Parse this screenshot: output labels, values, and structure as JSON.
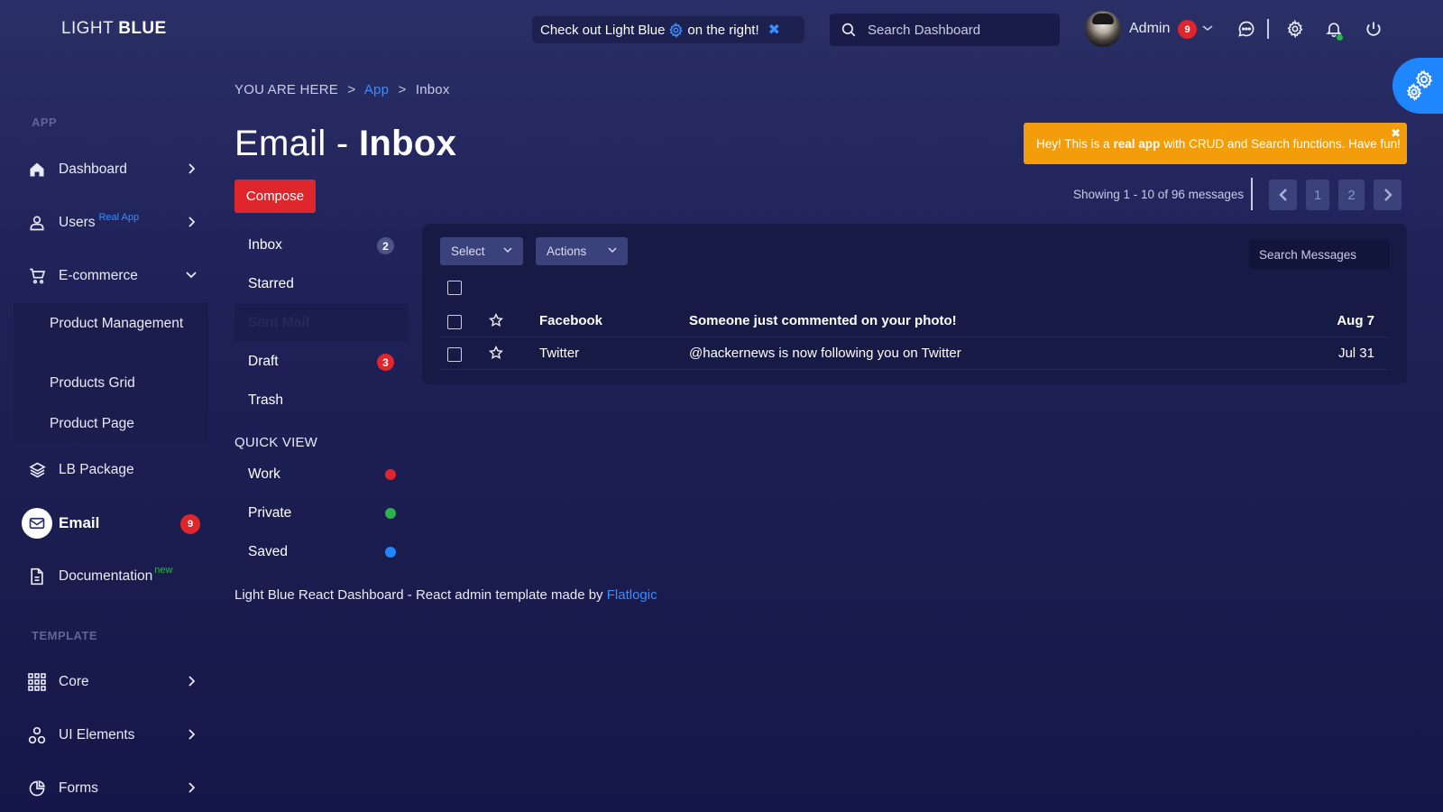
{
  "brand": {
    "light": "LIGHT",
    "bold": "BLUE"
  },
  "promo": {
    "text_before": "Check out Light Blue",
    "text_after": "on the right!",
    "close": "✖"
  },
  "header": {
    "search_placeholder": "Search Dashboard",
    "user_name": "Admin",
    "user_badge": "9",
    "icons": [
      "chat-icon",
      "settings-icon",
      "bell-icon",
      "power-icon"
    ]
  },
  "sidebar": {
    "section_app": "APP",
    "section_template": "TEMPLATE",
    "items": {
      "dashboard": "Dashboard",
      "users": "Users",
      "users_tag": "Real App",
      "ecommerce": "E-commerce",
      "product_management": "Product Management",
      "products_grid": "Products Grid",
      "product_page": "Product Page",
      "lb_package": "LB Package",
      "email": "Email",
      "email_badge": "9",
      "documentation": "Documentation",
      "documentation_tag": "new",
      "core": "Core",
      "ui_elements": "UI Elements",
      "forms": "Forms"
    }
  },
  "breadcrumb": {
    "prefix": "YOU ARE HERE",
    "app": "App",
    "current": "Inbox",
    "separator": ">"
  },
  "title": {
    "light": "Email - ",
    "bold": "Inbox"
  },
  "alert": {
    "before": "Hey! This is a",
    "bold": "real app",
    "after": "with CRUD and Search functions. Have fun!",
    "close": "✖"
  },
  "compose_label": "Compose",
  "pagination": {
    "showing": "Showing 1 - 10 of 96 messages",
    "pages": [
      "1",
      "2"
    ]
  },
  "folders": {
    "inbox": "Inbox",
    "inbox_count": "2",
    "starred": "Starred",
    "sent": "Sent Mail",
    "draft": "Draft",
    "draft_count": "3",
    "trash": "Trash"
  },
  "quick_view": {
    "heading": "QUICK VIEW",
    "items": [
      {
        "label": "Work",
        "color": "#e0262d"
      },
      {
        "label": "Private",
        "color": "#2bb24c"
      },
      {
        "label": "Saved",
        "color": "#1e86ff"
      }
    ]
  },
  "messages_panel": {
    "select_label": "Select",
    "actions_label": "Actions",
    "search_placeholder": "Search Messages",
    "messages": [
      {
        "from": "Facebook",
        "subject": "Someone just commented on your photo!",
        "date": "Aug 7",
        "unread": true
      },
      {
        "from": "Twitter",
        "subject": "@hackernews is now following you on Twitter",
        "date": "Jul 31",
        "unread": false
      }
    ]
  },
  "footer": {
    "text": "Light Blue React Dashboard - React admin template made by",
    "link": "Flatlogic"
  },
  "colors": {
    "accent": "#1e86ff",
    "danger": "#e0262d",
    "warning": "#f49d0b",
    "success": "#2bb24c"
  }
}
